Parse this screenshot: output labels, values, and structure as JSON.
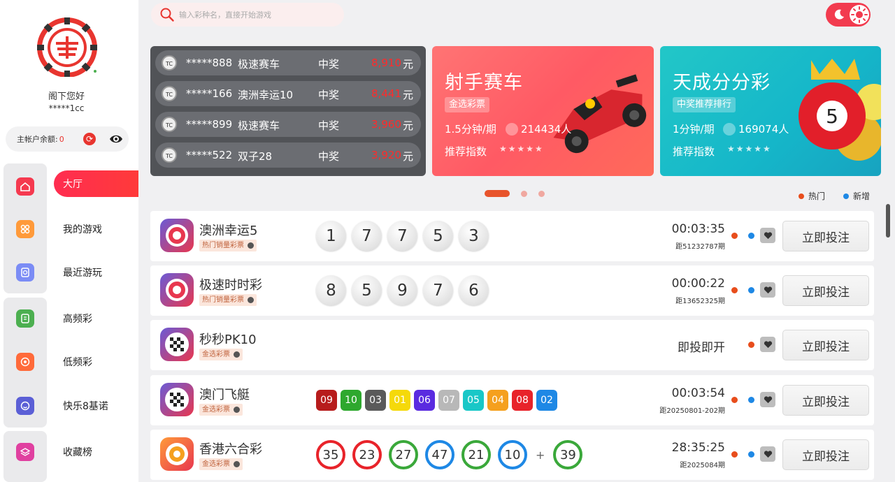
{
  "search": {
    "placeholder": "输入彩种名，直接开始游戏"
  },
  "user": {
    "greeting": "阁下您好",
    "username": "*****1cc",
    "balance_label": "主帐户余额:",
    "balance_value": "0"
  },
  "nav": [
    {
      "label": "大厅",
      "icon": "home-icon",
      "color": "#f5394f",
      "active": true
    },
    {
      "label": "我的游戏",
      "icon": "grid-icon",
      "color": "#ff9a3a"
    },
    {
      "label": "最近游玩",
      "icon": "clock-icon",
      "color": "#7b8cf5"
    },
    {
      "label": "高频彩",
      "icon": "ticket-icon",
      "color": "#4caf50"
    },
    {
      "label": "低频彩",
      "icon": "target-icon",
      "color": "#ff6a3a"
    },
    {
      "label": "快乐8基诺",
      "icon": "smile-icon",
      "color": "#5b5fd6"
    },
    {
      "label": "收藏榜",
      "icon": "layers-icon",
      "color": "#e040a0"
    }
  ],
  "winners": [
    {
      "user": "*****888",
      "game": "极速赛车",
      "label": "中奖",
      "amount": "8,910",
      "unit": "元"
    },
    {
      "user": "*****166",
      "game": "澳洲幸运10",
      "label": "中奖",
      "amount": "8,441",
      "unit": "元"
    },
    {
      "user": "*****899",
      "game": "极速赛车",
      "label": "中奖",
      "amount": "3,960",
      "unit": "元"
    },
    {
      "user": "*****522",
      "game": "双子28",
      "label": "中奖",
      "amount": "3,920",
      "unit": "元"
    }
  ],
  "winner_badge": "TC",
  "banners": [
    {
      "title": "射手赛车",
      "tag": "金选彩票",
      "meta": "1.5分钟/期",
      "players": "214434人",
      "rate_label": "推荐指数"
    },
    {
      "title": "天成分分彩",
      "tag": "中奖推荐排行",
      "meta": "1分钟/期",
      "players": "169074人",
      "rate_label": "推荐指数"
    }
  ],
  "legend": {
    "hot": "热门",
    "new": "新增"
  },
  "colors": {
    "hot": "#e84d1c",
    "new": "#1e88e5",
    "accent": "#f5394f"
  },
  "games": [
    {
      "name": "澳洲幸运5",
      "tag": "热门销量彩票",
      "balls": [
        "1",
        "7",
        "7",
        "5",
        "3"
      ],
      "countdown": "00:03:35",
      "period": "距51232787期",
      "bet": "立即投注"
    },
    {
      "name": "极速时时彩",
      "tag": "热门销量彩票",
      "balls": [
        "8",
        "5",
        "9",
        "7",
        "6"
      ],
      "countdown": "00:00:22",
      "period": "距13652325期",
      "bet": "立即投注"
    },
    {
      "name": "秒秒PK10",
      "tag": "金选彩票",
      "instant": "即投即开",
      "bet": "立即投注"
    },
    {
      "name": "澳门飞艇",
      "tag": "金选彩票",
      "sq_balls": [
        "09",
        "10",
        "03",
        "01",
        "06",
        "07",
        "05",
        "04",
        "08",
        "02"
      ],
      "countdown": "00:03:54",
      "period": "距20250801-202期",
      "bet": "立即投注"
    },
    {
      "name": "香港六合彩",
      "tag": "金选彩票",
      "hk_balls": [
        "35",
        "23",
        "27",
        "47",
        "21",
        "10"
      ],
      "hk_special": "39",
      "plus": "+",
      "countdown": "28:35:25",
      "period": "距2025084期",
      "bet": "立即投注"
    }
  ]
}
